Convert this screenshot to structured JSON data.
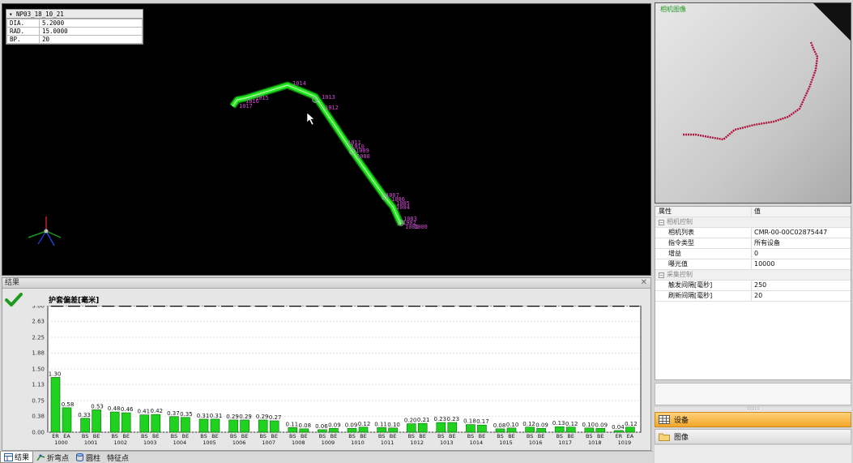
{
  "viewport": {
    "info_title": "NP03_18_10_21",
    "info_rows": [
      {
        "key": "DIA.",
        "value": "5.2000"
      },
      {
        "key": "RAD.",
        "value": "15.0000"
      },
      {
        "key": "BP.",
        "value": "20"
      }
    ],
    "node_labels": [
      "1017",
      "1016",
      "1015",
      "1014",
      "1013",
      "1012",
      "1011",
      "1010",
      "1009",
      "1008",
      "1007",
      "1006",
      "1005",
      "1004",
      "1003",
      "1002",
      "1001",
      "1000"
    ],
    "tube_color": "#22e61e",
    "label_color": "#d54bd5"
  },
  "results": {
    "title": "结果",
    "close": "✕",
    "chart_title": "护套偏差[毫米]"
  },
  "chart_data": {
    "type": "bar",
    "title": "护套偏差[毫米]",
    "yticks": [
      "3.00",
      "2.63",
      "2.25",
      "1.88",
      "1.50",
      "1.13",
      "0.75",
      "0.38",
      "0.00"
    ],
    "ylim": [
      0,
      3.0
    ],
    "threshold": 3.0,
    "bar_color": "#1ed21e",
    "groups": [
      {
        "id": "1000",
        "labels": [
          "ER",
          "EA"
        ],
        "values": [
          1.3,
          0.58
        ],
        "texts": [
          "1.30",
          "0.58"
        ]
      },
      {
        "id": "1001",
        "labels": [
          "BS",
          "BE"
        ],
        "values": [
          0.33,
          0.53
        ],
        "texts": [
          "0.33",
          "0.53"
        ]
      },
      {
        "id": "1002",
        "labels": [
          "BS",
          "BE"
        ],
        "values": [
          0.48,
          0.46
        ],
        "texts": [
          "0.48",
          "0.46"
        ]
      },
      {
        "id": "1003",
        "labels": [
          "BS",
          "BE"
        ],
        "values": [
          0.41,
          0.42
        ],
        "texts": [
          "0.41",
          "0.42"
        ]
      },
      {
        "id": "1004",
        "labels": [
          "BS",
          "BE"
        ],
        "values": [
          0.37,
          0.35
        ],
        "texts": [
          "0.37",
          "0.35"
        ]
      },
      {
        "id": "1005",
        "labels": [
          "BS",
          "BE"
        ],
        "values": [
          0.31,
          0.31
        ],
        "texts": [
          "0.31",
          "0.31"
        ]
      },
      {
        "id": "1006",
        "labels": [
          "BS",
          "BE"
        ],
        "values": [
          0.29,
          0.29
        ],
        "texts": [
          "0.29",
          "0.29"
        ]
      },
      {
        "id": "1007",
        "labels": [
          "BS",
          "BE"
        ],
        "values": [
          0.29,
          0.27
        ],
        "texts": [
          "0.29",
          "0.27"
        ]
      },
      {
        "id": "1008",
        "labels": [
          "BS",
          "BE"
        ],
        "values": [
          0.11,
          0.08
        ],
        "texts": [
          "0.11",
          "0.08"
        ]
      },
      {
        "id": "1009",
        "labels": [
          "BS",
          "BE"
        ],
        "values": [
          0.06,
          0.09
        ],
        "texts": [
          "0.06",
          "0.09"
        ]
      },
      {
        "id": "1010",
        "labels": [
          "BS",
          "BE"
        ],
        "values": [
          0.09,
          0.12
        ],
        "texts": [
          "0.09",
          "0.12"
        ]
      },
      {
        "id": "1011",
        "labels": [
          "BS",
          "BE"
        ],
        "values": [
          0.11,
          0.1
        ],
        "texts": [
          "0.11",
          "0.10"
        ]
      },
      {
        "id": "1012",
        "labels": [
          "BS",
          "BE"
        ],
        "values": [
          0.2,
          0.21
        ],
        "texts": [
          "0.20",
          "0.21"
        ]
      },
      {
        "id": "1013",
        "labels": [
          "BS",
          "BE"
        ],
        "values": [
          0.23,
          0.23
        ],
        "texts": [
          "0.23",
          "0.23"
        ]
      },
      {
        "id": "1014",
        "labels": [
          "BS",
          "BE"
        ],
        "values": [
          0.18,
          0.17
        ],
        "texts": [
          "0.18",
          "0.17"
        ]
      },
      {
        "id": "1015",
        "labels": [
          "BS",
          "BE"
        ],
        "values": [
          0.08,
          0.1
        ],
        "texts": [
          "0.08",
          "0.10"
        ]
      },
      {
        "id": "1016",
        "labels": [
          "BS",
          "BE"
        ],
        "values": [
          0.12,
          0.09
        ],
        "texts": [
          "0.12",
          "0.09"
        ]
      },
      {
        "id": "1017",
        "labels": [
          "BS",
          "BE"
        ],
        "values": [
          0.13,
          0.12
        ],
        "texts": [
          "0.13",
          "0.12"
        ]
      },
      {
        "id": "1018",
        "labels": [
          "BS",
          "BE"
        ],
        "values": [
          0.1,
          0.09
        ],
        "texts": [
          "0.10",
          "0.09"
        ]
      },
      {
        "id": "1019",
        "labels": [
          "ER",
          "EA"
        ],
        "values": [
          0.04,
          0.12
        ],
        "texts": [
          "0.04",
          "0.12"
        ]
      }
    ]
  },
  "tabs": [
    {
      "label": "结果",
      "icon": "table-icon",
      "active": true
    },
    {
      "label": "折弯点",
      "icon": "bend-point-icon",
      "active": false
    },
    {
      "label": "圆柱",
      "icon": "cylinder-icon",
      "active": false
    },
    {
      "label": "特征点",
      "icon": "feature-point-icon",
      "active": false
    }
  ],
  "properties": {
    "col_property": "属性",
    "col_value": "值",
    "sections": [
      {
        "name": "相机控制",
        "items": [
          {
            "key": "相机列表",
            "value": "CMR-00-00C02875447"
          },
          {
            "key": "指令类型",
            "value": "所有设备"
          },
          {
            "key": "增益",
            "value": "0"
          },
          {
            "key": "曝光值",
            "value": "10000"
          }
        ]
      },
      {
        "name": "采集控制",
        "items": [
          {
            "key": "触发间隔[毫秒]",
            "value": "250"
          },
          {
            "key": "刷新间隔[毫秒]",
            "value": "20"
          }
        ]
      }
    ]
  },
  "nav": {
    "splitter": "::::::::",
    "devices": "设备",
    "images": "图像"
  },
  "camera": {
    "label": "相机图像",
    "line_color": "#b0103c"
  }
}
